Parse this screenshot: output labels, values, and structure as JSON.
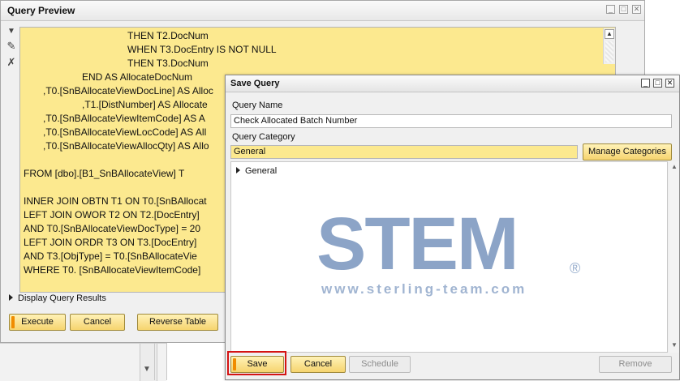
{
  "query_preview": {
    "title": "Query Preview",
    "code_lines": [
      "THEN T2.DocNum",
      "WHEN T3.DocEntry IS NOT NULL",
      "THEN T3.DocNum",
      "END AS AllocateDocNum",
      ",T0.[SnBAllocateViewDocLine] AS Alloc",
      ",T1.[DistNumber] AS Allocate",
      ",T0.[SnBAllocateViewItemCode] AS A",
      ",T0.[SnBAllocateViewLocCode] AS All",
      ",T0.[SnBAllocateViewAllocQty] AS Allo",
      "FROM [dbo].[B1_SnBAllocateView] T",
      "INNER JOIN OBTN T1 ON T0.[SnBAllocat",
      "LEFT JOIN OWOR T2 ON T2.[DocEntry]",
      "AND T0.[SnBAllocateViewDocType] = 20",
      "LEFT JOIN ORDR T3 ON T3.[DocEntry]",
      "AND T3.[ObjType] = T0.[SnBAllocateVie",
      "WHERE T0. [SnBAllocateViewItemCode]"
    ],
    "display_results": "Display Query Results",
    "buttons": {
      "execute": "Execute",
      "cancel": "Cancel",
      "reverse_table": "Reverse Table"
    }
  },
  "save_query": {
    "title": "Save Query",
    "query_name_label": "Query Name",
    "query_name_value": "Check Allocated Batch Number",
    "query_category_label": "Query Category",
    "query_category_value": "General",
    "manage_categories": "Manage Categories",
    "tree_items": [
      "General"
    ],
    "buttons": {
      "save": "Save",
      "cancel": "Cancel",
      "schedule": "Schedule",
      "remove": "Remove"
    }
  },
  "watermark": {
    "logo": "STEM",
    "reg": "®",
    "url": "www.sterling-team.com"
  },
  "colors": {
    "field_yellow": "#fce98f",
    "button_accent": "#f08c00",
    "highlight": "#d41414"
  }
}
